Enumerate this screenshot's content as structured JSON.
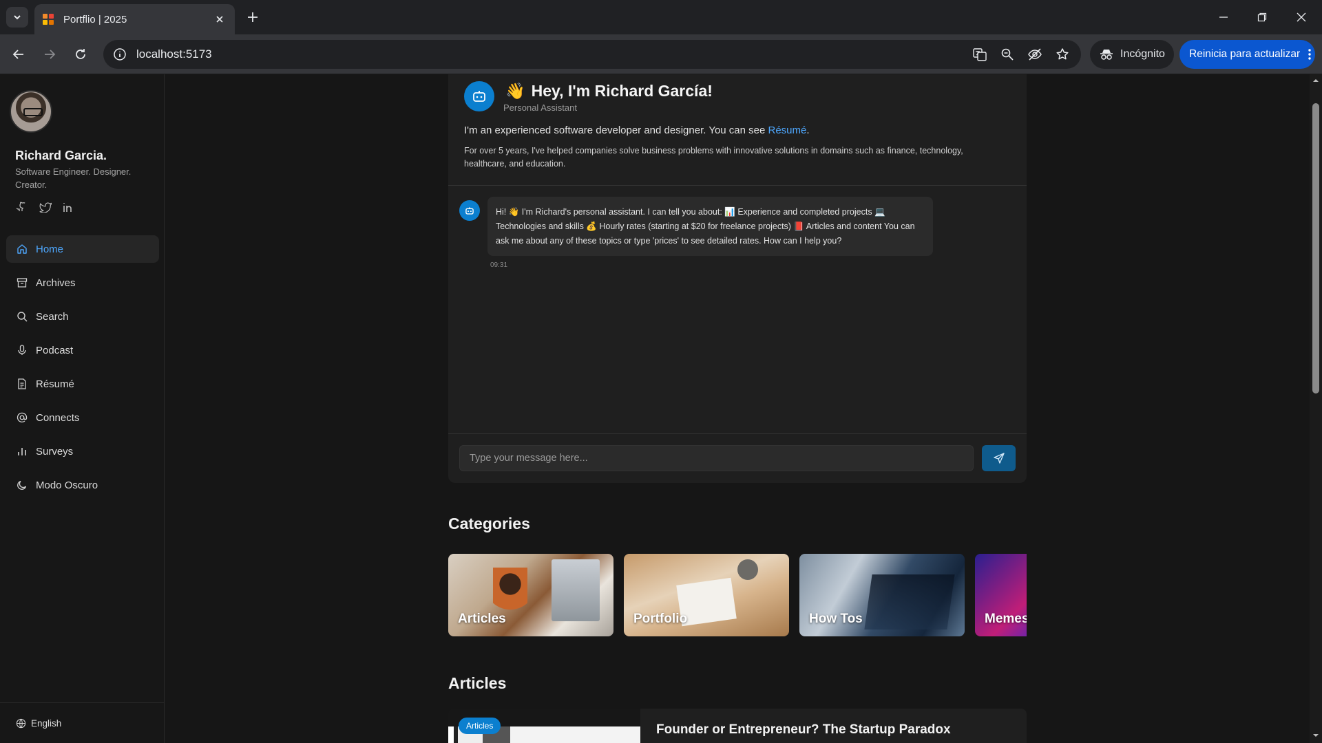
{
  "browser": {
    "tab_title": "Portflio | 2025",
    "url": "localhost:5173",
    "incognito_label": "Incógnito",
    "update_label": "Reinicia para actualizar"
  },
  "sidebar": {
    "name": "Richard Garcia.",
    "tagline": "Software Engineer. Designer. Creator.",
    "socials": [
      "github-icon",
      "twitter-icon",
      "linkedin-icon"
    ],
    "items": [
      {
        "label": "Home",
        "icon": "home-icon",
        "active": true
      },
      {
        "label": "Archives",
        "icon": "archive-icon"
      },
      {
        "label": "Search",
        "icon": "search-icon"
      },
      {
        "label": "Podcast",
        "icon": "microphone-icon"
      },
      {
        "label": "Résumé",
        "icon": "document-icon"
      },
      {
        "label": "Connects",
        "icon": "at-icon"
      },
      {
        "label": "Surveys",
        "icon": "bar-chart-icon"
      },
      {
        "label": "Modo Oscuro",
        "icon": "moon-icon"
      }
    ],
    "language": "English"
  },
  "chat": {
    "title": "Hey, I'm Richard García!",
    "title_emoji": "👋",
    "subtitle": "Personal Assistant",
    "intro_text": "I'm an experienced software developer and designer. You can see ",
    "intro_link": "Résumé",
    "intro_end": ".",
    "description": "For over 5 years, I've helped companies solve business problems with innovative solutions in domains such as finance, technology, healthcare, and education.",
    "message": "Hi! 👋 I'm Richard's personal assistant. I can tell you about: 📊 Experience and completed projects 💻 Technologies and skills 💰 Hourly rates (starting at $20 for freelance projects) 📕 Articles and content You can ask me about any of these topics or type 'prices' to see detailed rates. How can I help you?",
    "time": "09:31",
    "input_placeholder": "Type your message here..."
  },
  "categories": {
    "title": "Categories",
    "items": [
      "Articles",
      "Portfolio",
      "How Tos",
      "Memes"
    ]
  },
  "articles": {
    "title": "Articles",
    "first": {
      "badge": "Articles",
      "title": "Founder or Entrepreneur? The Startup Paradox"
    }
  },
  "colors": {
    "accent": "#0b7fcf",
    "link": "#4ea8ff",
    "chrome_update": "#0b57d0"
  }
}
